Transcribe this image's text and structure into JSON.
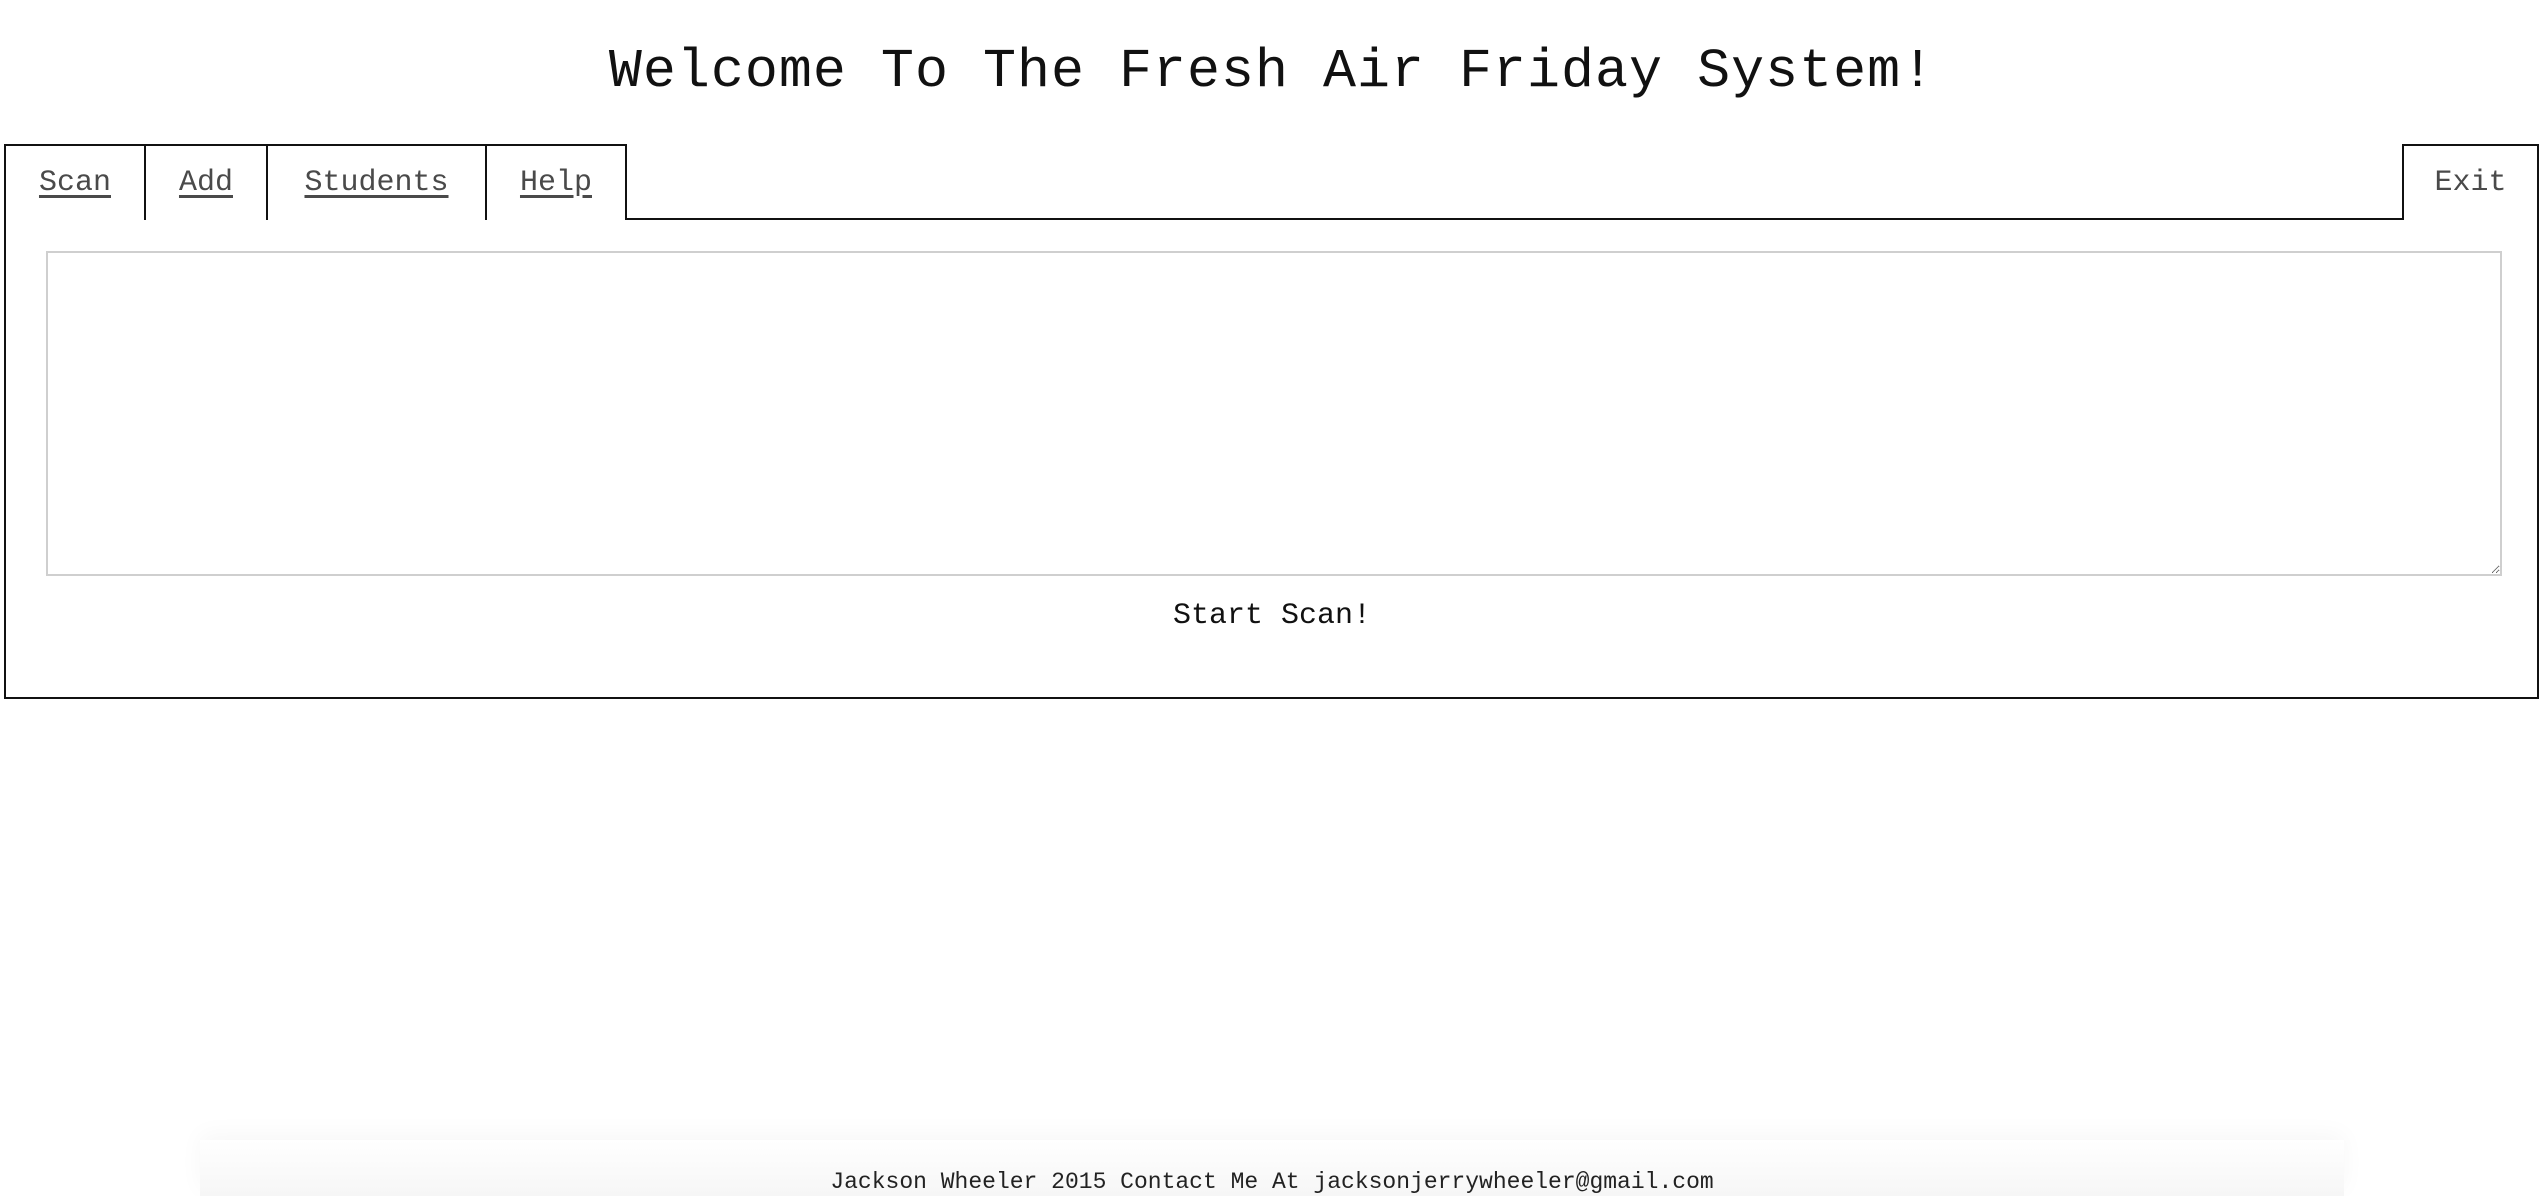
{
  "header": {
    "title": "Welcome To The Fresh Air Friday System!"
  },
  "nav": {
    "tabs": [
      {
        "label": "Scan"
      },
      {
        "label": "Add"
      },
      {
        "label": "Students"
      },
      {
        "label": "Help"
      }
    ],
    "exit_label": "Exit"
  },
  "scan": {
    "input_value": "",
    "start_button_label": "Start Scan!"
  },
  "footer": {
    "text": "Jackson Wheeler 2015 Contact Me At jacksonjerrywheeler@gmail.com"
  },
  "colors": {
    "border": "#111111",
    "tab_text": "#4a4a4a",
    "input_border": "#cfcfcf",
    "background": "#ffffff"
  }
}
